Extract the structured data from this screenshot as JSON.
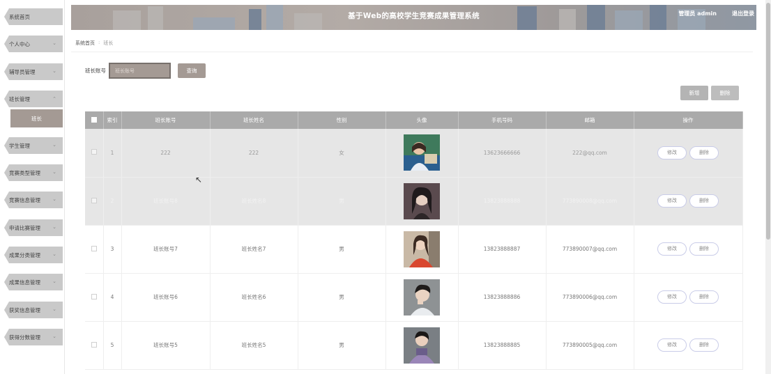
{
  "sidebar": {
    "items": [
      {
        "label": "系统首页",
        "chevron": false
      },
      {
        "label": "个人中心",
        "chevron": true
      },
      {
        "label": "辅导员管理",
        "chevron": true
      },
      {
        "label": "班长管理",
        "chevron": true,
        "expanded": true
      },
      {
        "label": "学生管理",
        "chevron": true
      },
      {
        "label": "竞赛类型管理",
        "chevron": true
      },
      {
        "label": "竞赛信息管理",
        "chevron": true
      },
      {
        "label": "申请比赛管理",
        "chevron": true
      },
      {
        "label": "成果分类管理",
        "chevron": true
      },
      {
        "label": "成果信息管理",
        "chevron": true
      },
      {
        "label": "获奖信息管理",
        "chevron": true
      },
      {
        "label": "获得分数管理",
        "chevron": true
      }
    ],
    "sub_item": "班长"
  },
  "header": {
    "title": "基于Web的高校学生竞赛成果管理系统",
    "user": "管理员 admin",
    "logout": "退出登录"
  },
  "breadcrumb": {
    "home": "系统首页",
    "sep": ":",
    "current": "班长"
  },
  "search": {
    "label": "班长账号",
    "placeholder": "班长账号",
    "button": "查询"
  },
  "actions": {
    "add": "新增",
    "delete": "删除"
  },
  "table": {
    "headers": [
      "",
      "索引",
      "班长账号",
      "班长姓名",
      "性别",
      "头像",
      "手机号码",
      "邮箱",
      "操作"
    ],
    "rows": [
      {
        "index": "1",
        "account": "222",
        "name": "222",
        "gender": "女",
        "phone": "13623666666",
        "email": "222@qq.com",
        "edit": "修改",
        "delete": "删除"
      },
      {
        "index": "2",
        "account": "班长账号8",
        "name": "班长姓名8",
        "gender": "男",
        "phone": "13823888888",
        "email": "773890008@qq.com",
        "edit": "修改",
        "delete": "删除"
      },
      {
        "index": "3",
        "account": "班长账号7",
        "name": "班长姓名7",
        "gender": "男",
        "phone": "13823888887",
        "email": "773890007@qq.com",
        "edit": "修改",
        "delete": "删除"
      },
      {
        "index": "4",
        "account": "班长账号6",
        "name": "班长姓名6",
        "gender": "男",
        "phone": "13823888886",
        "email": "773890006@qq.com",
        "edit": "修改",
        "delete": "删除"
      },
      {
        "index": "5",
        "account": "班长账号5",
        "name": "班长姓名5",
        "gender": "男",
        "phone": "13823888885",
        "email": "773890005@qq.com",
        "edit": "修改",
        "delete": "删除"
      }
    ]
  }
}
